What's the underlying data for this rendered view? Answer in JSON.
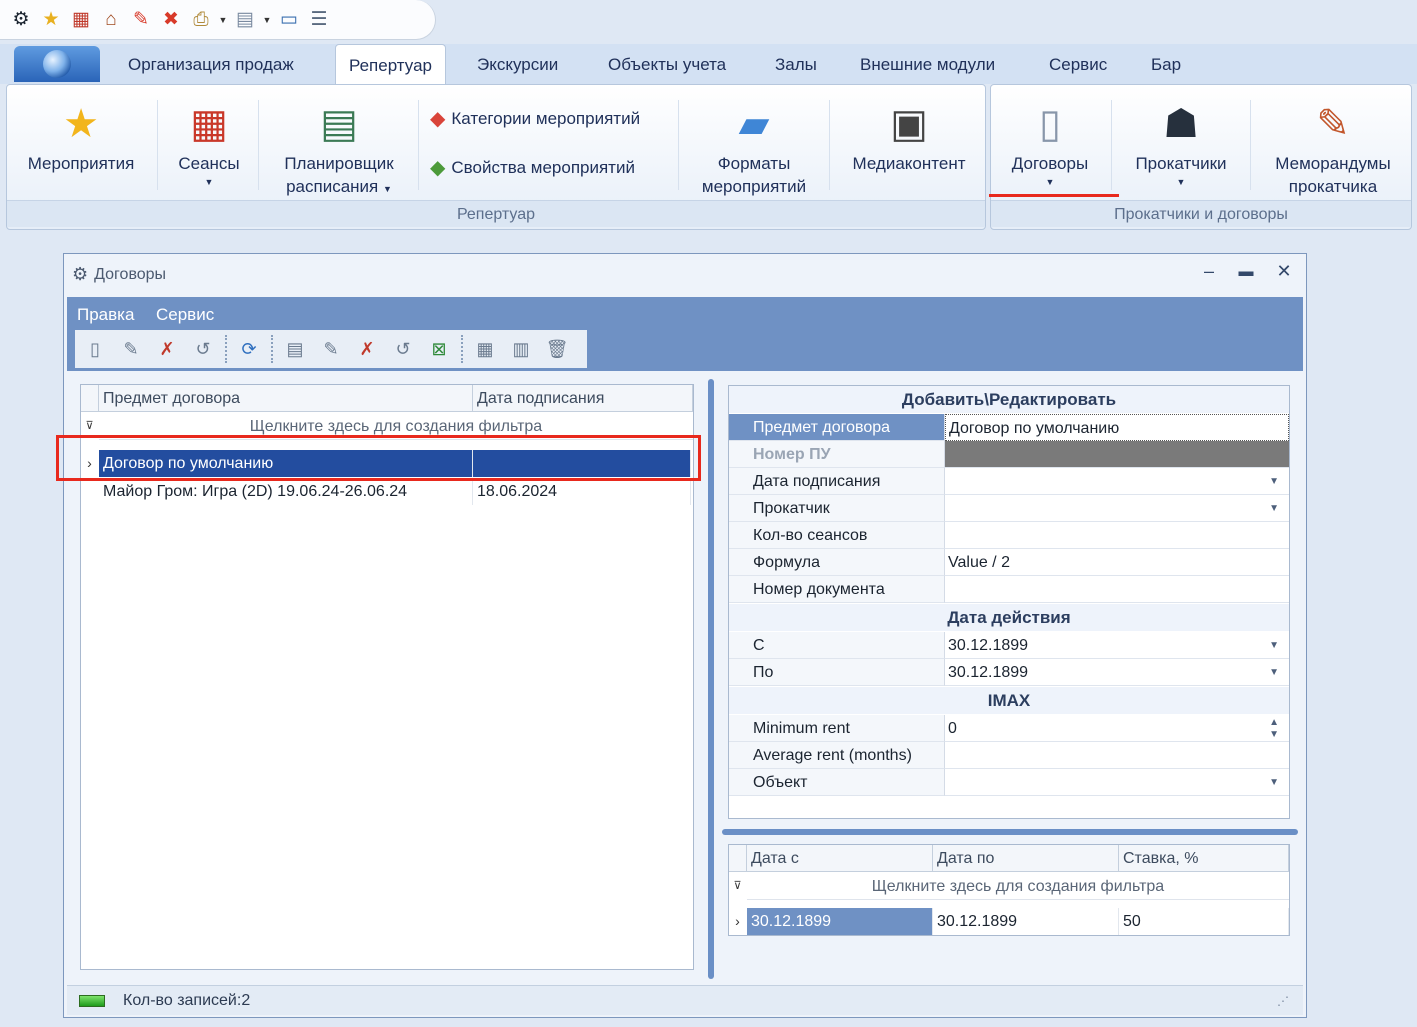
{
  "app": {
    "quick_access_icons": [
      "app-logo-icon",
      "star-icon",
      "calendar-icon",
      "shop-icon",
      "pencil-icon",
      "delete-mark-icon",
      "printer-icon",
      "document-icon",
      "monitor-icon",
      "list-icon"
    ]
  },
  "ribbon_tabs": [
    "Организация продаж",
    "Репертуар",
    "Экскурсии",
    "Объекты учета",
    "Залы",
    "Внешние модули",
    "Сервис",
    "Бар"
  ],
  "ribbon": {
    "events": "Мероприятия",
    "sessions": "Сеансы",
    "scheduler_line1": "Планировщик",
    "scheduler_line2": "расписания",
    "event_categories": "Категории мероприятий",
    "event_properties": "Свойства мероприятий",
    "formats_line1": "Форматы",
    "formats_line2": "мероприятий",
    "media": "Медиаконтент",
    "group_repertoire": "Репертуар",
    "contracts": "Договоры",
    "distributors": "Прокатчики",
    "memos_line1": "Меморандумы",
    "memos_line2": "прокатчика",
    "group_distributors": "Прокатчики и договоры"
  },
  "window": {
    "title": "Договоры",
    "menu": [
      "Правка",
      "Сервис"
    ]
  },
  "contracts_grid": {
    "columns": [
      "Предмет договора",
      "Дата подписания"
    ],
    "filter_hint": "Щелкните здесь для создания фильтра",
    "rows": [
      {
        "subject": "Договор по умолчанию",
        "date": ""
      },
      {
        "subject": "Майор Гром: Игра (2D) 19.06.24-26.06.24",
        "date": "18.06.2024"
      }
    ]
  },
  "editor": {
    "header": "Добавить\\Редактировать",
    "subject_label": "Предмет договора",
    "subject_value": "Договор по умолчанию",
    "pu_label": "Номер ПУ",
    "sign_date_label": "Дата подписания",
    "distributor_label": "Прокатчик",
    "sessions_label": "Кол-во сеансов",
    "formula_label": "Формула",
    "formula_value": "Value / 2",
    "doc_number_label": "Номер документа",
    "validity_header": "Дата действия",
    "from_label": "С",
    "from_value": "30.12.1899",
    "to_label": "По",
    "to_value": "30.12.1899",
    "imax_header": "IMAX",
    "min_rent_label": "Minimum rent",
    "min_rent_value": "0",
    "avg_rent_label": "Average rent (months)",
    "object_label": "Объект"
  },
  "rates_grid": {
    "columns": [
      "Дата с",
      "Дата по",
      "Ставка, %"
    ],
    "filter_hint": "Щелкните здесь для создания фильтра",
    "rows": [
      {
        "from": "30.12.1899",
        "to": "30.12.1899",
        "rate": "50"
      }
    ]
  },
  "status": {
    "records": "Кол-во записей:2"
  },
  "colors": {
    "highlight": "#e8291d",
    "selection": "#234d9f",
    "menu_bar": "#6f91c4"
  }
}
